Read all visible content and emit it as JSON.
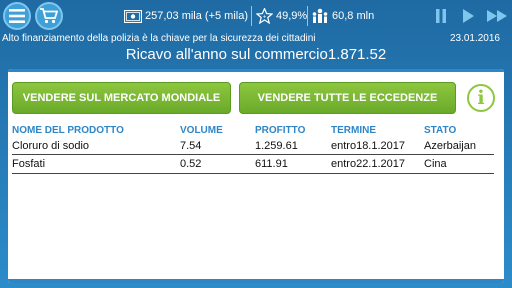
{
  "topbar": {
    "menu_icon": "hamburger-menu-icon",
    "cart_icon": "shopping-cart-icon",
    "money": "257,03 mila (+5 mila)",
    "approval": "49,9%",
    "population": "60,8 mln",
    "controls": [
      "pause-icon",
      "play-icon",
      "fast-forward-icon"
    ]
  },
  "news": {
    "headline": "Alto finanziamento della polizia è la chiave per la sicurezza dei cittadini",
    "date": "23.01.2016"
  },
  "revenue": "Ricavo all'anno sul commercio1.871.52",
  "actions": {
    "world_market": "VENDERE SUL MERCATO MONDIALE",
    "sell_surplus": "VENDERE TUTTE LE ECCEDENZE",
    "info": "i"
  },
  "table": {
    "headers": [
      "NOME DEL PRODOTTO",
      "VOLUME",
      "PROFITTO",
      "TERMINE",
      "STATO"
    ],
    "rows": [
      [
        "Cloruro di sodio",
        "7.54",
        "1.259.61",
        "entro18.1.2017",
        "Azerbaijan"
      ],
      [
        "Fosfati",
        "0.52",
        "611.91",
        "entro22.1.2017",
        "Cina"
      ]
    ]
  },
  "colors": {
    "background": "#2c8cc9",
    "accent_green": "#8dc63f",
    "header_blue": "#2f86c6"
  }
}
